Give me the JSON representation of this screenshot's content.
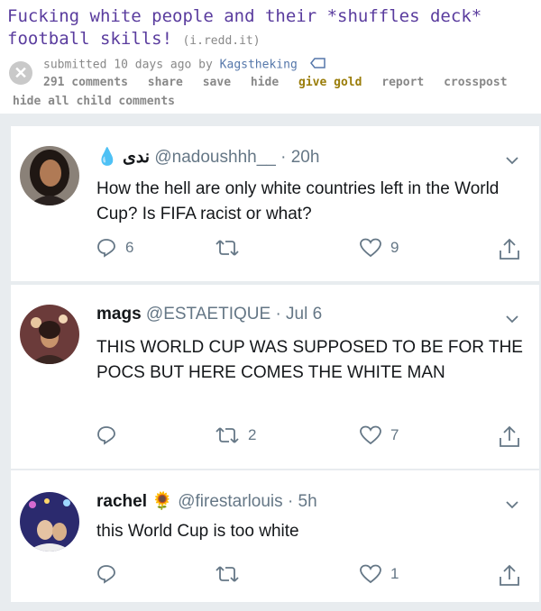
{
  "post": {
    "title": "Fucking white people and their *shuffles deck* football skills!",
    "domain": "(i.redd.it)",
    "submitted_prefix": "submitted 10 days ago by",
    "author": "Kagstheking",
    "actions": [
      "291 comments",
      "share",
      "save",
      "hide",
      "give gold",
      "report",
      "crosspost"
    ],
    "hide_child": "hide all child comments"
  },
  "tweets": [
    {
      "name": "ندى",
      "emoji": "💧",
      "handle": "@nadoushhh__",
      "time": "· 20h",
      "text": "How the hell are only white countries left in the World Cup? Is FIFA racist or what?",
      "replies": "6",
      "retweets": "",
      "likes": "9"
    },
    {
      "name": "mags",
      "emoji": "",
      "handle": "@ESTAETIQUE",
      "time": "· Jul 6",
      "text": "THIS WORLD CUP WAS SUPPOSED TO BE FOR THE POCS BUT HERE COMES THE WHITE MAN",
      "replies": "",
      "retweets": "2",
      "likes": "7"
    },
    {
      "name": "rachel",
      "emoji": "🌻",
      "handle": "@firestarlouis",
      "time": "· 5h",
      "text": "this World Cup is too white",
      "replies": "",
      "retweets": "",
      "likes": "1"
    }
  ],
  "colors": {
    "reddit_title": "#5a3c9e",
    "twitter_text": "#14171a",
    "twitter_gray": "#657786",
    "background": "#e8ecef"
  }
}
